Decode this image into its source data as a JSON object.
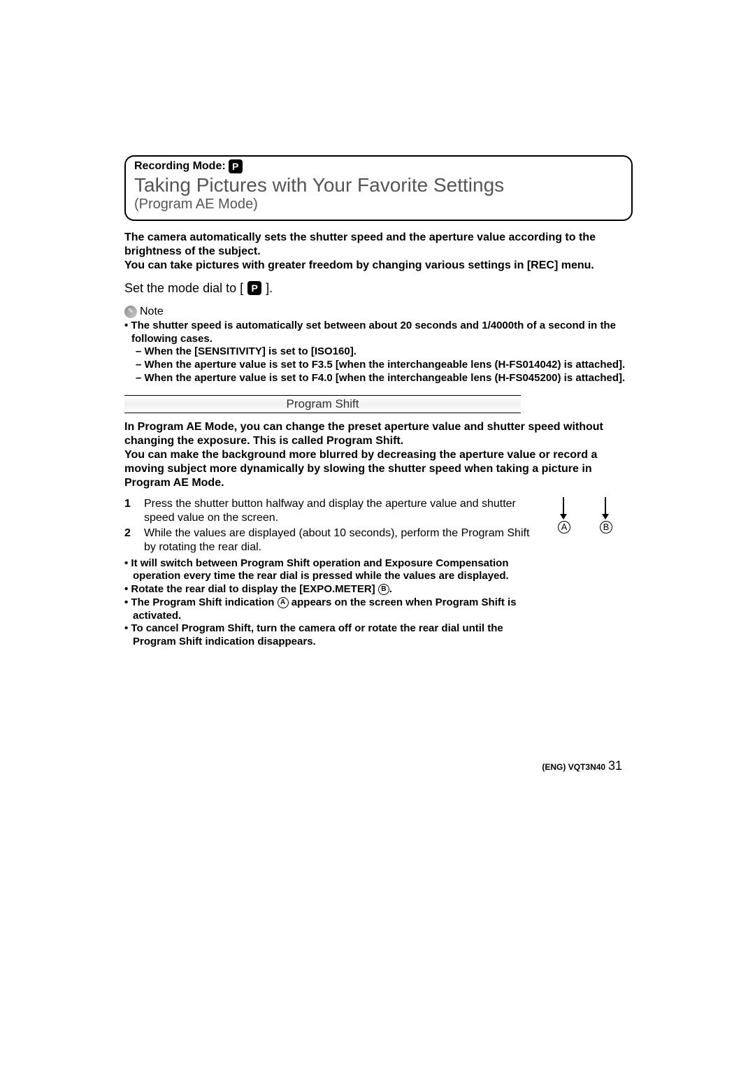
{
  "header": {
    "recModeLabel": "Recording Mode:",
    "pIcon": "P",
    "title": "Taking Pictures with Your Favorite Settings",
    "subtitle": "(Program AE Mode)"
  },
  "intro": {
    "line1": "The camera automatically sets the shutter speed and the aperture value according to the brightness of the subject.",
    "line2": "You can take pictures with greater freedom by changing various settings in [REC] menu."
  },
  "setDial": {
    "text": "Set the mode dial to [",
    "icon": "P",
    "close": "]."
  },
  "note": {
    "label": "Note",
    "b1": "• The shutter speed is automatically set between about 20 seconds and 1/4000th of a second in the following cases.",
    "s1": "– When the [SENSITIVITY] is set to [ISO160].",
    "s2": "– When the aperture value is set to F3.5 [when the interchangeable lens (H-FS014042) is attached].",
    "s3": "– When the aperture value is set to F4.0 [when the interchangeable lens (H-FS045200) is attached]."
  },
  "programShift": {
    "heading": "Program Shift",
    "intro": "In Program AE Mode, you can change the preset aperture value and shutter speed without changing the exposure. This is called Program Shift.",
    "intro2": "You can make the background more blurred by decreasing the aperture value or record a moving subject more dynamically by slowing the shutter speed when taking a picture in Program AE Mode.",
    "steps": {
      "n1": "1",
      "t1": "Press the shutter button halfway and display the aperture value and shutter speed value on the screen.",
      "n2": "2",
      "t2": "While the values are displayed (about 10 seconds), perform the Program Shift by rotating the rear dial."
    },
    "labels": {
      "a": "A",
      "b": "B"
    },
    "follow": {
      "f1": "• It will switch between Program Shift operation and Exposure Compensation operation every time the rear dial is pressed while the values are displayed.",
      "f2_pre": "• Rotate the rear dial to display the [EXPO.METER] ",
      "f2_b": "B",
      "f2_post": ".",
      "f3_pre": "• The Program Shift indication ",
      "f3_a": "A",
      "f3_post": " appears on the screen when Program Shift is activated.",
      "f4": "• To cancel Program Shift, turn the camera off or rotate the rear dial until the Program Shift indication disappears."
    }
  },
  "footer": {
    "code": "(ENG) VQT3N40",
    "page": "31"
  }
}
